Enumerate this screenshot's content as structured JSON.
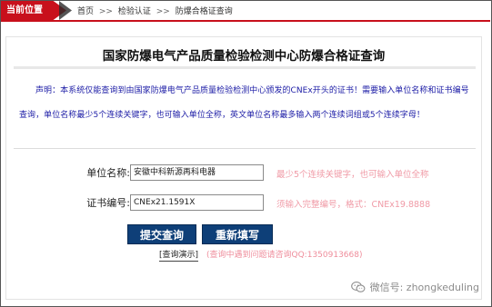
{
  "location": {
    "tag_label": "当前位置",
    "breadcrumb": [
      "首页",
      ">>",
      "检验认证",
      ">>",
      "防爆合格证查询"
    ]
  },
  "page": {
    "title": "国家防爆电气产品质量检验检测中心防爆合格证查询",
    "notice": "声明：本系统仅能查询到由国家防爆电气产品质量检验检测中心颁发的CNEx开头的证书！需要输入单位名称和证书编号查询，单位名称最少5个连续关键字，也可输入单位全称，英文单位名称最多输入两个连续词组或5个连续字母！"
  },
  "form": {
    "unit_label": "单位名称:",
    "unit_value": "安徽中科新源再科电器",
    "unit_hint": "最少5个连续关键字，也可输入单位全称",
    "cert_label": "证书编号:",
    "cert_value": "CNEx21.1591X",
    "cert_hint": "须输入完整编号，格式：CNEx19.8888"
  },
  "buttons": {
    "submit": "提交查询",
    "reset": "重新填写"
  },
  "footer": {
    "demo_link": "[查询演示]",
    "contact": "(查询中遇到问题请咨询QQ:1350913668)"
  },
  "watermark": {
    "text": "微信号: zhongkeduling",
    "icon": "wechat-icon"
  },
  "colors": {
    "accent_red": "#c8101c",
    "notice_blue": "#1c1ca6",
    "button_navy": "#0e3f78",
    "hint_pink": "#f09aa6"
  }
}
